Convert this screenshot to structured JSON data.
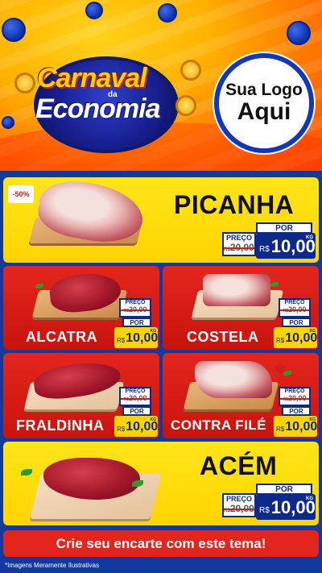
{
  "header": {
    "campaign_line1": "Carnaval",
    "campaign_da": "da",
    "campaign_line2": "Economia",
    "logo_line1": "Sua Logo",
    "logo_line2": "Aqui"
  },
  "products": [
    {
      "name": "PICANHA",
      "discount": "-50%",
      "preco_label": "PREÇO",
      "old_prefix": "R$",
      "old_price": "20,00",
      "por_label": "POR",
      "currency": "R$",
      "price": "10,00",
      "unit": "KG"
    },
    {
      "name": "ALCATRA",
      "preco_label": "PREÇO",
      "old_prefix": "R$",
      "old_price": "20,00",
      "por_label": "POR",
      "currency": "R$",
      "price": "10,00",
      "unit": "KG"
    },
    {
      "name": "COSTELA",
      "preco_label": "PREÇO",
      "old_prefix": "R$",
      "old_price": "20,00",
      "por_label": "POR",
      "currency": "R$",
      "price": "10,00",
      "unit": "KG"
    },
    {
      "name": "FRALDINHA",
      "preco_label": "PREÇO",
      "old_prefix": "R$",
      "old_price": "20,00",
      "por_label": "POR",
      "currency": "R$",
      "price": "10,00",
      "unit": "KG"
    },
    {
      "name": "CONTRA FILÉ",
      "preco_label": "PREÇO",
      "old_prefix": "R$",
      "old_price": "20,00",
      "por_label": "POR",
      "currency": "R$",
      "price": "10,00",
      "unit": "KG"
    },
    {
      "name": "ACÉM",
      "preco_label": "PREÇO",
      "old_prefix": "R$",
      "old_price": "20,00",
      "por_label": "POR",
      "currency": "R$",
      "price": "10,00",
      "unit": "KG"
    }
  ],
  "cta": "Crie seu encarte com este tema!",
  "disclaimer": "*Imagens Meramente Ilustrativas",
  "colors": {
    "brand_blue": "#0d2a8a",
    "promo_red": "#e3261d",
    "promo_yellow": "#ffd400"
  }
}
